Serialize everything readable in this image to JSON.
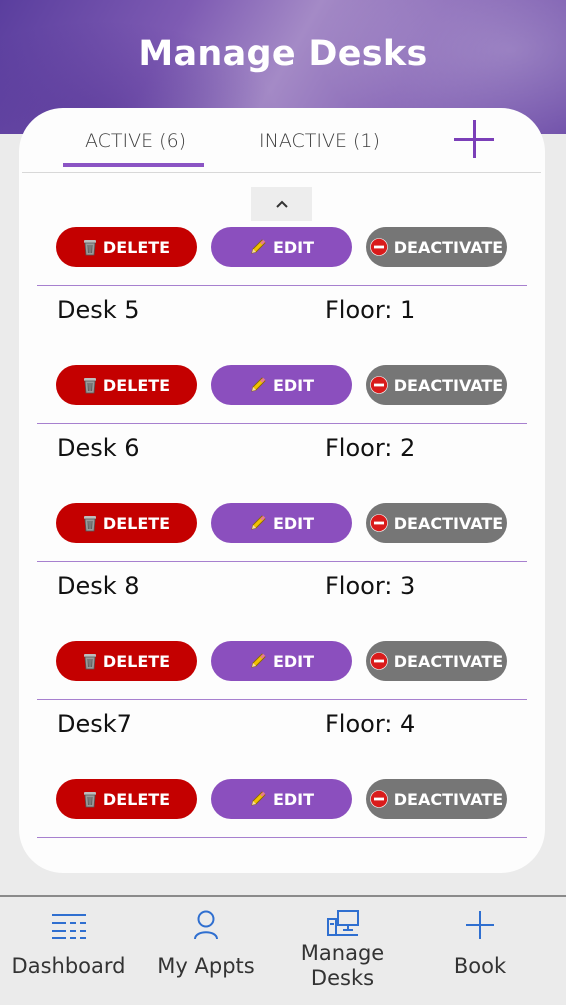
{
  "header": {
    "title": "Manage Desks"
  },
  "tabs": {
    "active_label": "ACTIVE (6)",
    "inactive_label": "INACTIVE (1)"
  },
  "actions": {
    "delete": "DELETE",
    "edit": "EDIT",
    "deactivate": "DEACTIVATE"
  },
  "desks": [
    {
      "name": "Desk 5",
      "floor": "Floor: 1"
    },
    {
      "name": "Desk 6",
      "floor": "Floor: 2"
    },
    {
      "name": "Desk 8",
      "floor": "Floor: 3"
    },
    {
      "name": "Desk7",
      "floor": "Floor: 4"
    }
  ],
  "bottom_nav": [
    {
      "label": "Dashboard",
      "icon": "list-icon"
    },
    {
      "label": "My Appts",
      "icon": "person-icon"
    },
    {
      "label": "Manage\nDesks",
      "icon": "desk-monitor-icon"
    },
    {
      "label": "Book",
      "icon": "plus-icon"
    }
  ],
  "colors": {
    "accent": "#8b4fbe",
    "delete": "#c40000",
    "deactivate": "#767676",
    "nav_icon": "#2f6fd0"
  }
}
